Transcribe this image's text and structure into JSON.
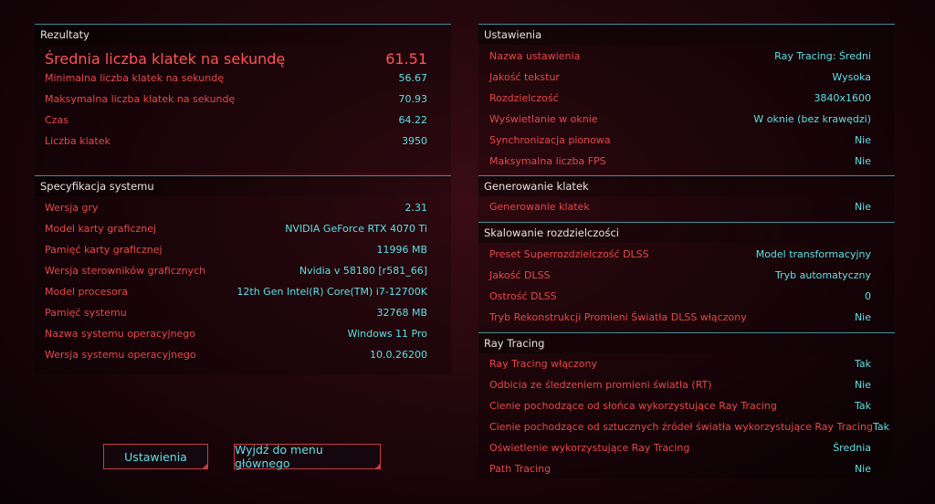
{
  "results": {
    "title": "Rezultaty",
    "rows": [
      {
        "label": "Średnia liczba klatek na sekundę",
        "value": "61.51"
      },
      {
        "label": "Minimalna liczba klatek na sekundę",
        "value": "56.67"
      },
      {
        "label": "Maksymalna liczba klatek na sekundę",
        "value": "70.93"
      },
      {
        "label": "Czas",
        "value": "64.22"
      },
      {
        "label": "Liczba klatek",
        "value": "3950"
      }
    ]
  },
  "system": {
    "title": "Specyfikacja systemu",
    "rows": [
      {
        "label": "Wersja gry",
        "value": "2.31"
      },
      {
        "label": "Model karty graficznej",
        "value": "NVIDIA GeForce RTX 4070 Ti"
      },
      {
        "label": "Pamięć karty graficznej",
        "value": "11996 MB"
      },
      {
        "label": "Wersja sterowników graficznych",
        "value": "Nvidia v 58180 [r581_66]"
      },
      {
        "label": "Model procesora",
        "value": "12th Gen Intel(R) Core(TM) i7-12700K"
      },
      {
        "label": "Pamięć systemu",
        "value": "32768 MB"
      },
      {
        "label": "Nazwa systemu operacyjnego",
        "value": "Windows 11 Pro"
      },
      {
        "label": "Wersja systemu operacyjnego",
        "value": "10.0.26200"
      }
    ]
  },
  "buttons": {
    "settings": "Ustawienia",
    "exit": "Wyjdź do menu głównego"
  },
  "settings": {
    "title": "Ustawienia",
    "rows": [
      {
        "label": "Nazwa ustawienia",
        "value": "Ray Tracing: Średni"
      },
      {
        "label": "Jakość tekstur",
        "value": "Wysoka"
      },
      {
        "label": "Rozdzielczość",
        "value": "3840x1600"
      },
      {
        "label": "Wyświetlanie w oknie",
        "value": "W oknie (bez krawędzi)"
      },
      {
        "label": "Synchronizacja pionowa",
        "value": "Nie"
      },
      {
        "label": "Maksymalna liczba FPS",
        "value": "Nie"
      }
    ]
  },
  "framegen": {
    "title": "Generowanie klatek",
    "rows": [
      {
        "label": "Generowanie klatek",
        "value": "Nie"
      }
    ]
  },
  "scaling": {
    "title": "Skalowanie rozdzielczości",
    "rows": [
      {
        "label": "Preset Superrozdzielczość DLSS",
        "value": "Model transformacyjny"
      },
      {
        "label": "Jakość DLSS",
        "value": "Tryb automatyczny"
      },
      {
        "label": "Ostrość DLSS",
        "value": "0"
      },
      {
        "label": "Tryb Rekonstrukcji Promieni Światła DLSS włączony",
        "value": "Nie"
      }
    ]
  },
  "raytracing": {
    "title": "Ray Tracing",
    "rows": [
      {
        "label": "Ray Tracing włączony",
        "value": "Tak"
      },
      {
        "label": "Odbicia ze śledzeniem promieni światła (RT)",
        "value": "Nie"
      },
      {
        "label": "Cienie pochodzące od słońca wykorzystujące Ray Tracing",
        "value": "Tak"
      },
      {
        "label": "Cienie pochodzące od sztucznych źródeł światła wykorzystujące Ray Tracing",
        "value": "Tak"
      },
      {
        "label": "Oświetlenie wykorzystujące Ray Tracing",
        "value": "Średnia"
      },
      {
        "label": "Path Tracing",
        "value": "Nie"
      }
    ]
  },
  "colors": {
    "label_red": "#e8484b",
    "value_cyan": "#5fe0e6",
    "divider_teal": "#3f8f96",
    "background": "#23070c"
  }
}
